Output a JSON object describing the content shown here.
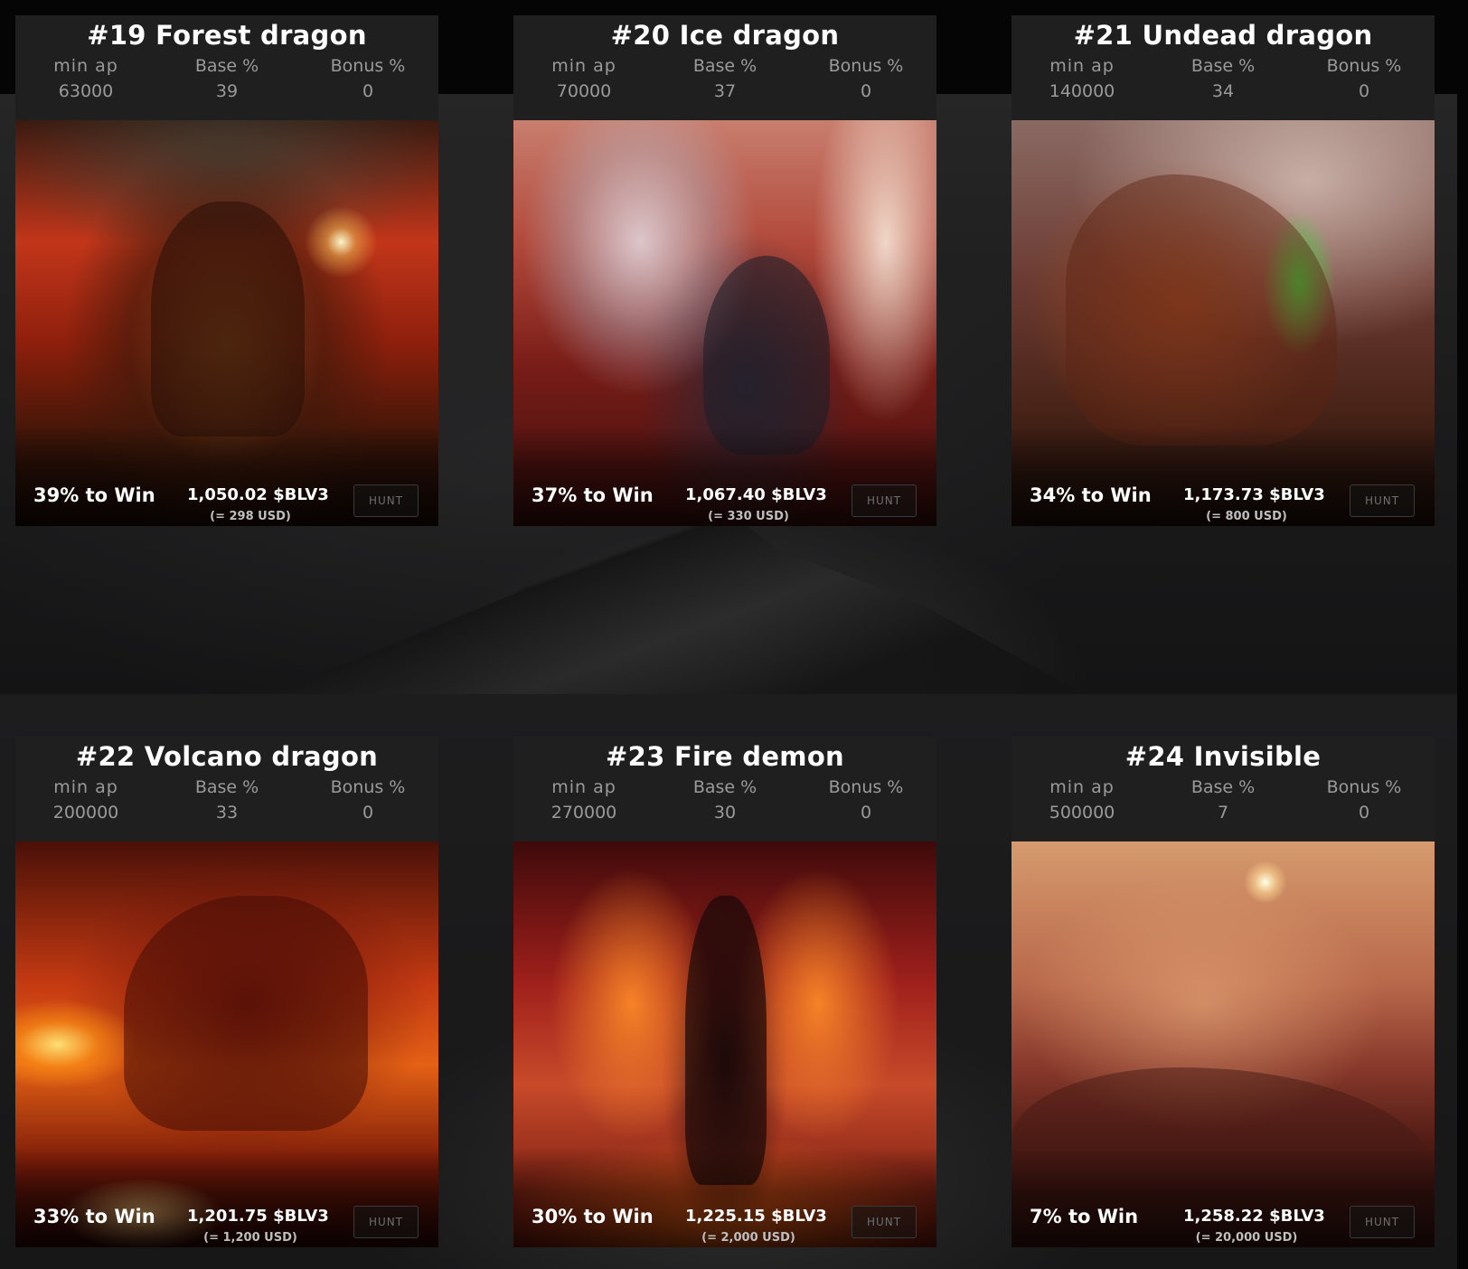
{
  "labels": {
    "min_ap": "min AP",
    "base": "Base %",
    "bonus": "Bonus %",
    "hunt": "HUNT"
  },
  "cards": [
    {
      "title": "#19 Forest dragon",
      "min_ap": "63000",
      "base": "39",
      "bonus": "0",
      "win": "39% to Win",
      "price": "1,050.02 $BLV3",
      "usd": "(= 298 USD)",
      "art": "forest-dragon-image"
    },
    {
      "title": "#20 Ice dragon",
      "min_ap": "70000",
      "base": "37",
      "bonus": "0",
      "win": "37% to Win",
      "price": "1,067.40 $BLV3",
      "usd": "(= 330 USD)",
      "art": "ice-dragon-image"
    },
    {
      "title": "#21 Undead dragon",
      "min_ap": "140000",
      "base": "34",
      "bonus": "0",
      "win": "34% to Win",
      "price": "1,173.73 $BLV3",
      "usd": "(= 800 USD)",
      "art": "undead-dragon-image"
    },
    {
      "title": "#22 Volcano dragon",
      "min_ap": "200000",
      "base": "33",
      "bonus": "0",
      "win": "33% to Win",
      "price": "1,201.75 $BLV3",
      "usd": "(= 1,200 USD)",
      "art": "volcano-dragon-image"
    },
    {
      "title": "#23 Fire demon",
      "min_ap": "270000",
      "base": "30",
      "bonus": "0",
      "win": "30% to Win",
      "price": "1,225.15 $BLV3",
      "usd": "(= 2,000 USD)",
      "art": "fire-demon-image"
    },
    {
      "title": "#24 Invisible",
      "min_ap": "500000",
      "base": "7",
      "bonus": "0",
      "win": "7% to Win",
      "price": "1,258.22 $BLV3",
      "usd": "(= 20,000 USD)",
      "art": "invisible-creature-image"
    }
  ]
}
